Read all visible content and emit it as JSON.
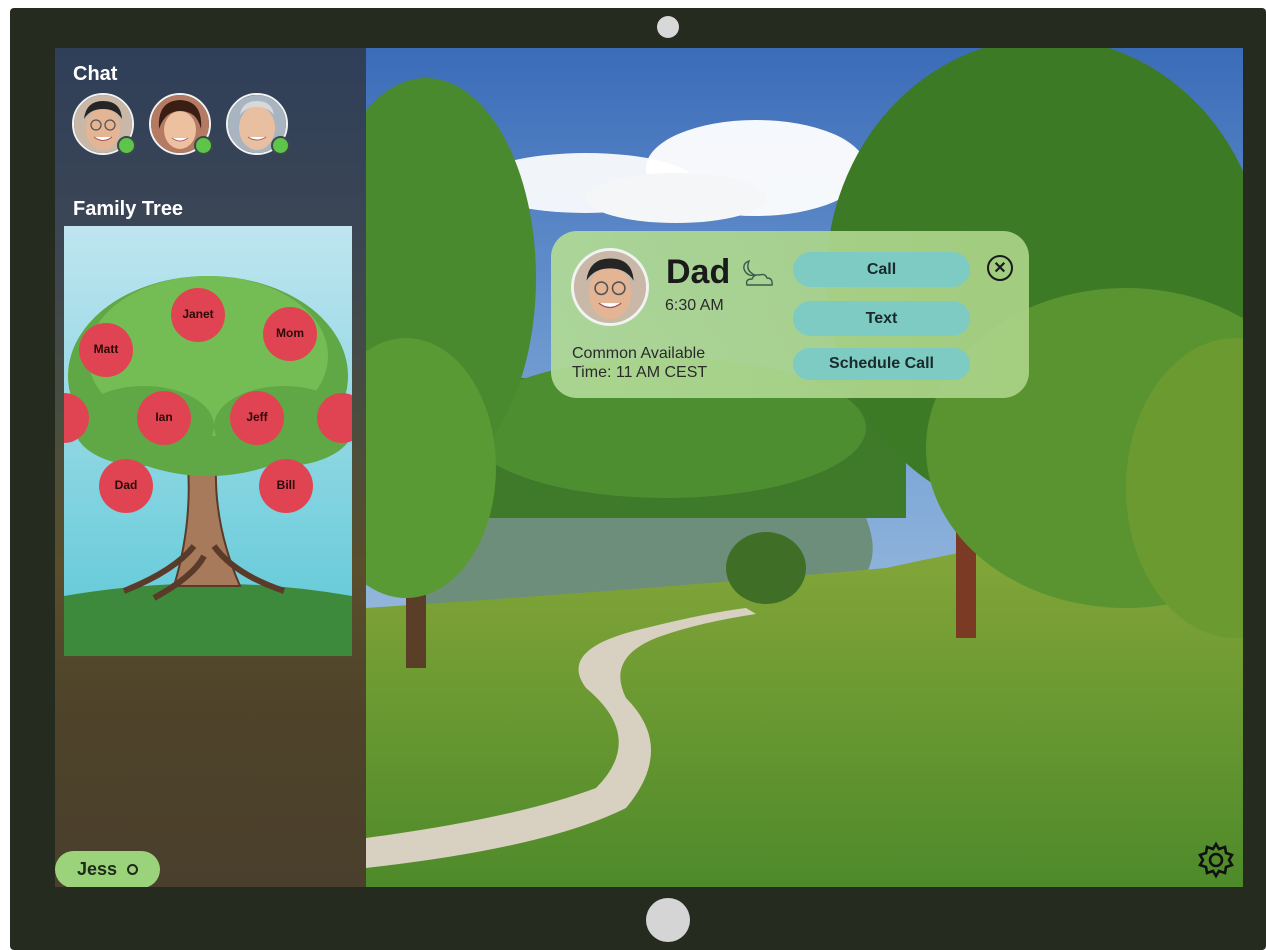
{
  "sidebar": {
    "chat_title": "Chat",
    "family_tree_title": "Family Tree",
    "contacts": [
      {
        "name": "contact-1",
        "status": "online"
      },
      {
        "name": "contact-2",
        "status": "online"
      },
      {
        "name": "contact-3",
        "status": "online"
      }
    ],
    "tree_members": [
      "Janet",
      "Matt",
      "Mom",
      "Ian",
      "Jeff",
      "Dad",
      "Bill"
    ],
    "user_pill": "Jess"
  },
  "popup": {
    "name": "Dad",
    "time": "6:30 AM",
    "common_line1": "Common Available",
    "common_line2": "Time: 11 AM CEST",
    "call_label": "Call",
    "text_label": "Text",
    "schedule_label": "Schedule Call",
    "close_icon": "close-icon",
    "weather_icon": "moon-cloud-icon"
  },
  "colors": {
    "online": "#5ec44a",
    "card_bg": "#afd996",
    "pill_bg": "#7ecbc4",
    "user_pill_bg": "#9ad37a"
  },
  "icons": {
    "settings": "gear-icon"
  }
}
